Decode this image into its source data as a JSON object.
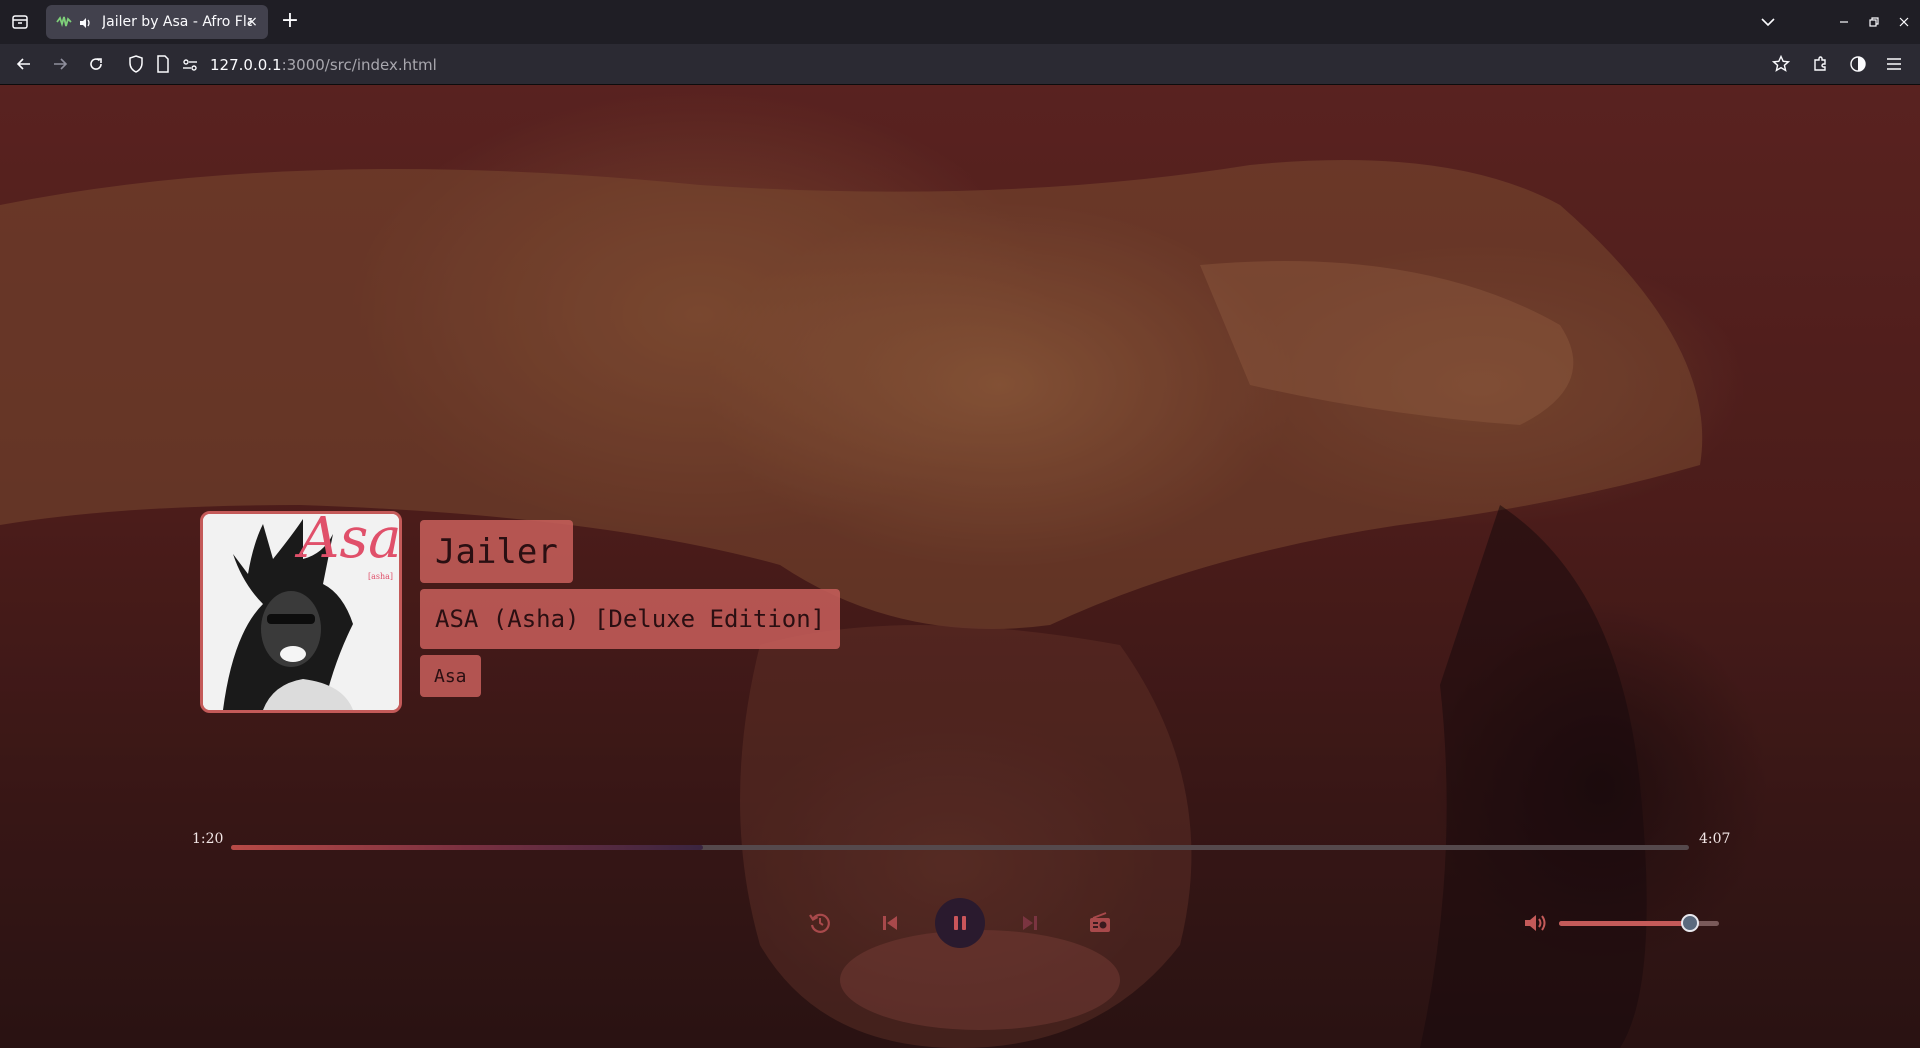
{
  "browser": {
    "tab_title": "Jailer by Asa - Afro Flash",
    "tab_close": "×",
    "new_tab": "+",
    "url_host": "127.0.0.1",
    "url_rest": ":3000/src/index.html"
  },
  "player": {
    "song_title": "Jailer",
    "album": "ASA (Asha) [Deluxe Edition]",
    "artist": "Asa",
    "cover_text": "Asa",
    "cover_subtext": "[asha]",
    "current_time": "1:20",
    "duration": "4:07",
    "progress_fraction": 0.324,
    "volume_fraction": 0.82,
    "state": "playing"
  },
  "icons": {
    "replay": "replay-icon",
    "previous": "skip-previous-icon",
    "pause": "pause-icon",
    "next": "skip-next-icon",
    "radio": "radio-icon",
    "volume": "volume-icon"
  },
  "colors": {
    "accent": "#c45a59",
    "text_dark": "#2a0f12"
  }
}
